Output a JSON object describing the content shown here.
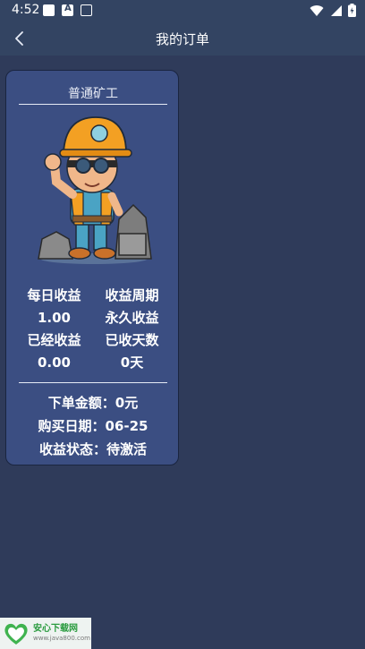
{
  "status": {
    "time": "4:52",
    "left_icons": [
      "app-icon",
      "font-icon",
      "screen-icon"
    ],
    "right_icons": [
      "wifi-icon",
      "signal-icon",
      "battery-icon"
    ]
  },
  "appbar": {
    "title": "我的订单",
    "back_icon": "chevron-left-icon"
  },
  "order": {
    "name": "普通矿工",
    "stats": [
      {
        "label": "每日收益",
        "value": "1.00"
      },
      {
        "label": "收益周期",
        "value": "永久收益"
      },
      {
        "label": "已经收益",
        "value": "0.00"
      },
      {
        "label": "已收天数",
        "value": "0天"
      }
    ],
    "amount": "下单金额：0元",
    "date": "购买日期：06-25",
    "status": "收益状态：待激活"
  },
  "watermark": {
    "main": "安心下载网",
    "sub": "www.java800.com",
    "logo_text": "安心"
  },
  "colors": {
    "background": "#2f3b5a",
    "bar": "#334462",
    "card": "#3b4e82",
    "helmet": "#f3a023"
  }
}
